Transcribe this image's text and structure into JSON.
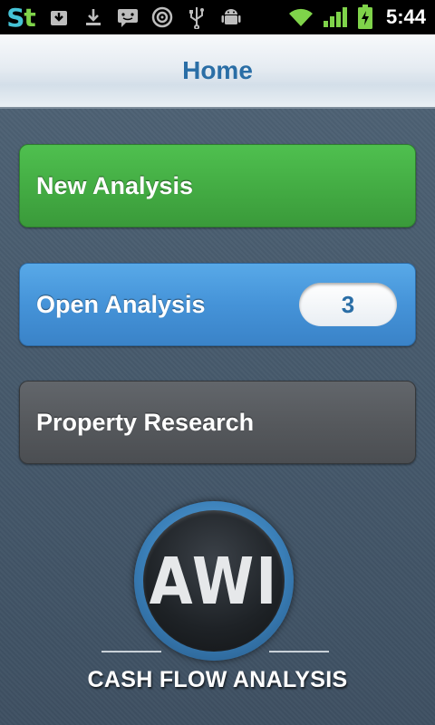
{
  "status_bar": {
    "app_logo": {
      "text_a": "S",
      "text_b": "t"
    },
    "notification_icons": [
      "download-box-icon",
      "download-arrow-icon",
      "chat-icon",
      "target-icon",
      "usb-icon",
      "android-icon"
    ],
    "right_icons": [
      "wifi-icon",
      "signal-icon",
      "battery-charging-icon"
    ],
    "time": "5:44",
    "colors": {
      "logo_s": "#45c3d6",
      "logo_t": "#7fd34a",
      "wifi": "#7fd34a",
      "battery": "#7fd34a"
    }
  },
  "header": {
    "title": "Home",
    "title_color": "#2a6ea6"
  },
  "menu": {
    "new_analysis": {
      "label": "New Analysis",
      "color": "#44ad44"
    },
    "open_analysis": {
      "label": "Open Analysis",
      "count": "3",
      "color": "#4593d8"
    },
    "property_research": {
      "label": "Property Research",
      "color": "#56595d"
    }
  },
  "logo": {
    "text": "AWI",
    "tagline": "CASH FLOW ANALYSIS"
  }
}
